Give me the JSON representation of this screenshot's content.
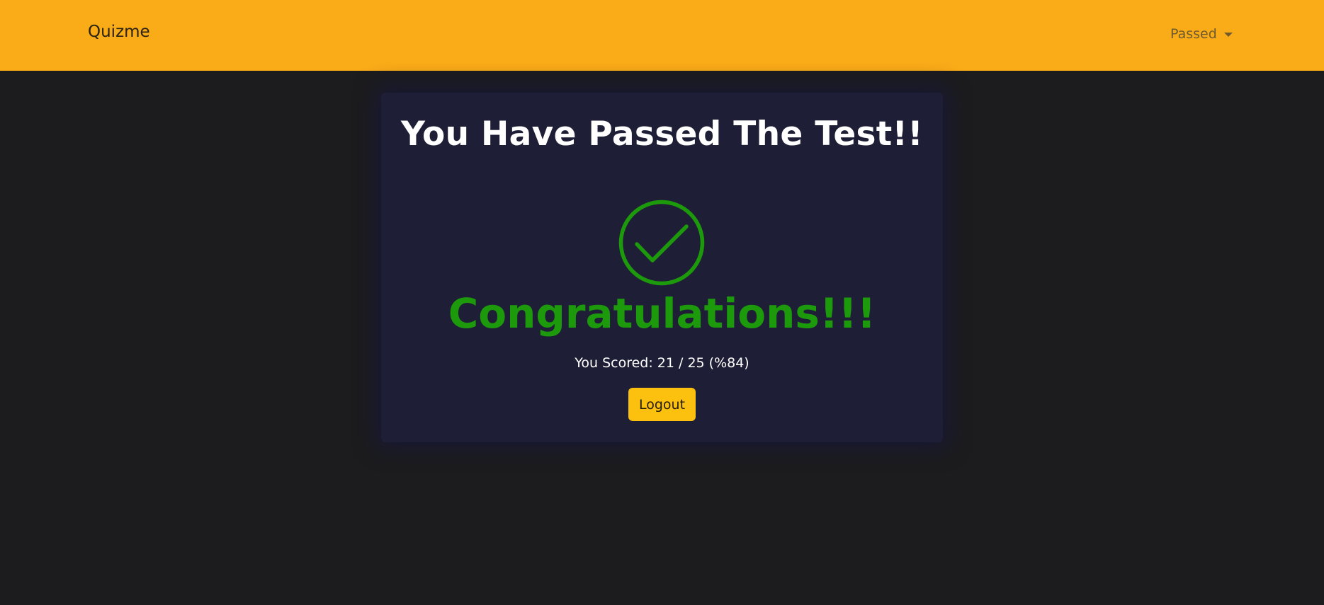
{
  "navbar": {
    "brand": "Quizme",
    "dropdown_label": "Passed"
  },
  "result": {
    "title": "You Have Passed The Test!!",
    "status_icon": "check-circle-icon",
    "headline": "Congratulations!!!",
    "score_text": "You Scored: 21 / 25 (%84)",
    "logout_label": "Logout"
  },
  "colors": {
    "navbar_bg": "#faab18",
    "page_bg": "#1c1c1e",
    "card_bg": "#1e1f36",
    "success": "#1d9a0c",
    "button": "#fcc00f"
  }
}
